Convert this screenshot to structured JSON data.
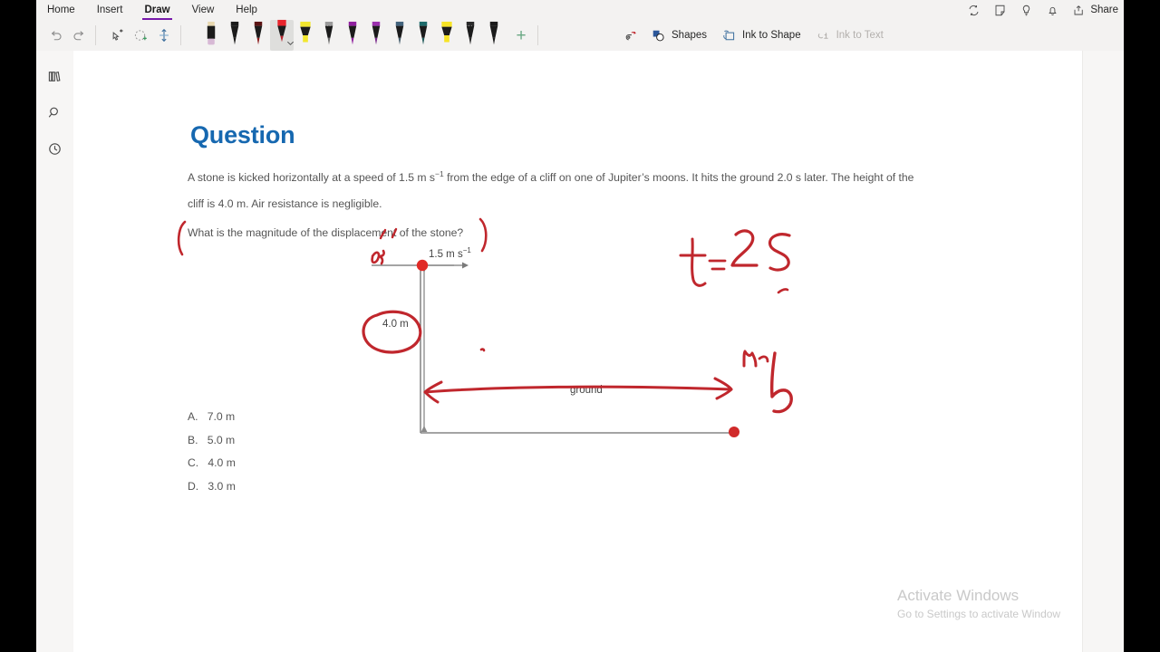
{
  "window": {
    "tabs": [
      {
        "label": "Home",
        "active": false
      },
      {
        "label": "Insert",
        "active": false
      },
      {
        "label": "Draw",
        "active": true
      },
      {
        "label": "View",
        "active": false
      },
      {
        "label": "Help",
        "active": false
      }
    ],
    "top_right": {
      "sync_icon": "sync-icon",
      "sticky_note_icon": "sticky-note-icon",
      "ideas_icon": "lightbulb-icon",
      "notifications_icon": "bell-icon",
      "share_label": "Share",
      "share_icon": "share-icon"
    }
  },
  "toolbar": {
    "undo_icon": "undo-icon",
    "redo_icon": "redo-icon",
    "lasso_icon": "lasso-select-icon",
    "add_space_icon": "insert-space-icon",
    "eraser_icon": "eraser-icon",
    "pens": [
      {
        "name": "eraser",
        "barrel": "#1b1b1b",
        "tip": "#d7b9d5",
        "cap": "#e8d8b0",
        "type": "eraser",
        "selected": false
      },
      {
        "name": "pen-black",
        "barrel": "#1b1b1b",
        "tip": "#1b1b1b",
        "cap": "#1b1b1b",
        "type": "pen",
        "selected": false
      },
      {
        "name": "pen-dark-red",
        "barrel": "#1b1b1b",
        "tip": "#8c1b1b",
        "cap": "#5c1414",
        "type": "pen",
        "selected": false
      },
      {
        "name": "pen-red",
        "barrel": "#1b1b1b",
        "tip": "#b5232b",
        "cap": "#e8242c",
        "type": "pen",
        "selected": true
      },
      {
        "name": "highlighter-yellow",
        "barrel": "#1b1b1b",
        "tip": "#f2e62e",
        "cap": "#f2e62e",
        "type": "highlighter",
        "selected": false
      },
      {
        "name": "pencil-grey",
        "barrel": "#1b1b1b",
        "tip": "#6b6b6b",
        "cap": "#9a9a9a",
        "type": "pencil",
        "selected": false
      },
      {
        "name": "pen-purple",
        "barrel": "#1b1b1b",
        "tip": "#8f1f9e",
        "cap": "#8f1f9e",
        "type": "pen",
        "selected": false
      },
      {
        "name": "pen-violet",
        "barrel": "#1b1b1b",
        "tip": "#7a2a8c",
        "cap": "#9b2fae",
        "type": "pen",
        "selected": false
      },
      {
        "name": "pen-blue-grey",
        "barrel": "#1b1b1b",
        "tip": "#4a6170",
        "cap": "#42637c",
        "type": "pen",
        "selected": false
      },
      {
        "name": "pen-teal",
        "barrel": "#1b1b1b",
        "tip": "#1f5a5a",
        "cap": "#1d6b6b",
        "type": "pen",
        "selected": false
      },
      {
        "name": "highlighter-yellow-2",
        "barrel": "#1b1b1b",
        "tip": "#f7e425",
        "cap": "#f7e425",
        "type": "highlighter",
        "selected": false
      },
      {
        "name": "pencil-black",
        "barrel": "#1b1b1b",
        "tip": "#2a2a2a",
        "cap": "#2a2a2a",
        "type": "pencil",
        "selected": false
      },
      {
        "name": "pen-black-2",
        "barrel": "#1b1b1b",
        "tip": "#1b1b1b",
        "cap": "#1b1b1b",
        "type": "pen",
        "selected": false
      }
    ],
    "add_pen_label": "+",
    "ruler_icon": "ruler-icon",
    "shapes_label": "Shapes",
    "shapes_icon": "shapes-icon",
    "ink_to_shape_label": "Ink to Shape",
    "ink_to_shape_icon": "ink-to-shape-icon",
    "ink_to_text_label": "Ink to Text",
    "ink_to_text_icon": "ink-to-text-icon",
    "ink_to_text_disabled": true
  },
  "rail": {
    "notebooks_icon": "notebooks-icon",
    "search_icon": "search-icon",
    "recent_icon": "recent-clock-icon"
  },
  "note": {
    "title": "Question",
    "title_color": "#1668b0",
    "paragraph_line1_a": "A stone is kicked horizontally at a speed of 1.5 m s",
    "paragraph_line1_sup": "−1",
    "paragraph_line1_b": " from the edge of a cliff on one of Jupiter’s moons. It hits the ground 2.0 s later. The height of the",
    "paragraph_line2": "cliff is 4.0 m. Air resistance is negligible.",
    "prompt": "What is the magnitude of the displacement of the stone?",
    "options": [
      {
        "letter": "A.",
        "value": "7.0 m"
      },
      {
        "letter": "B.",
        "value": "5.0 m"
      },
      {
        "letter": "C.",
        "value": "4.0 m"
      },
      {
        "letter": "D.",
        "value": "3.0 m"
      }
    ],
    "diagram": {
      "speed_label_a": "1.5 m s",
      "speed_label_sup": "−1",
      "height_label": "4.0 m",
      "ground_label": "ground"
    },
    "ink": {
      "color": "#c0272d",
      "time_annotation": "t = 2 s",
      "x_annotation": "x",
      "corner_annotation": "n b"
    }
  },
  "watermark": {
    "line1": "Activate Windows",
    "line2": "Go to Settings to activate Window"
  }
}
